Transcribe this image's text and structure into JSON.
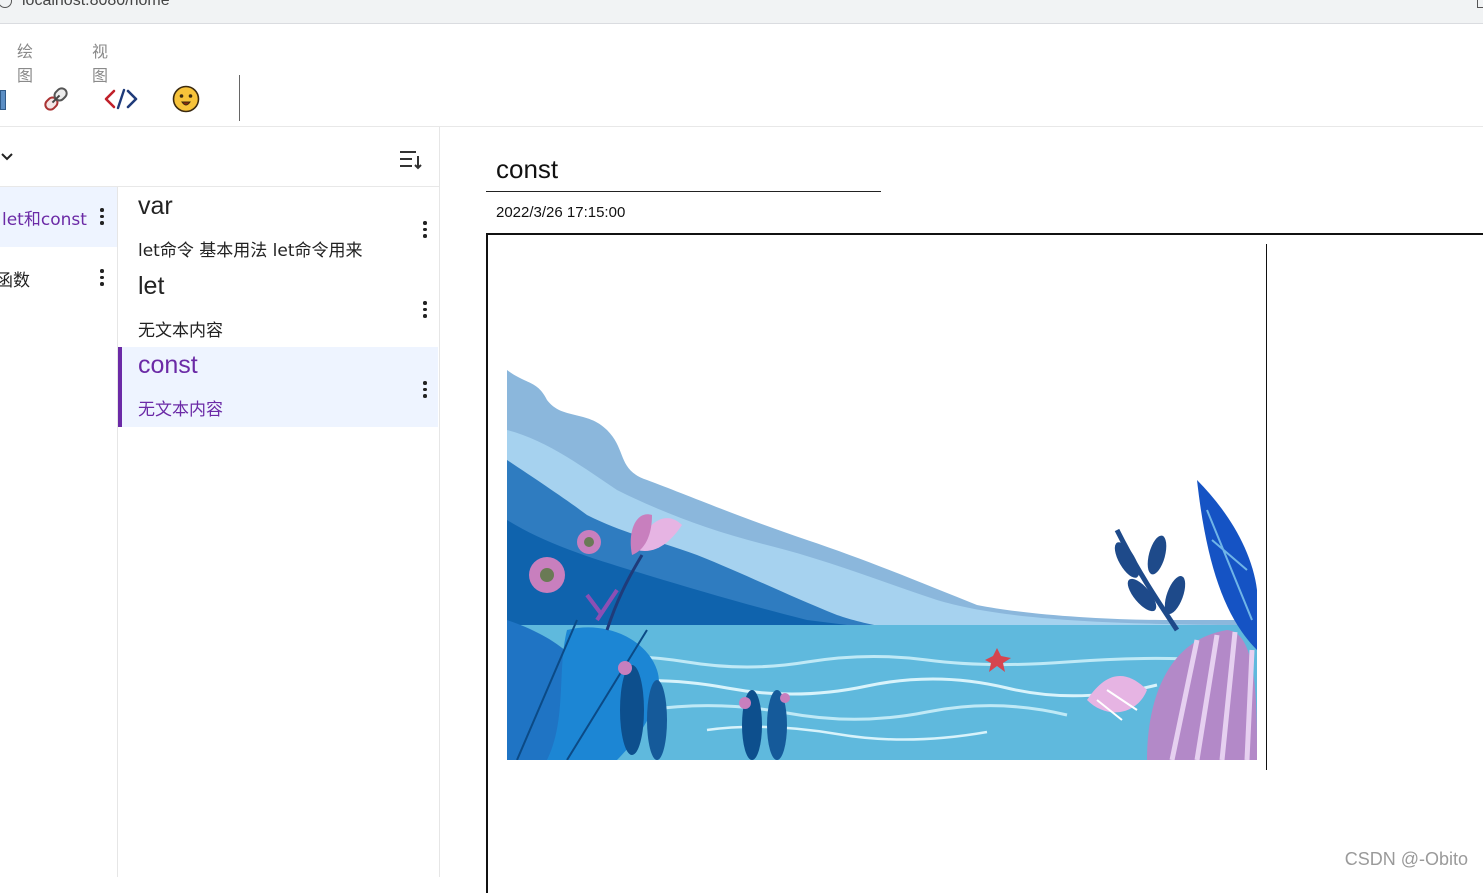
{
  "browser": {
    "url": "localhost:8080/home"
  },
  "menu": {
    "items": [
      "绘图",
      "视图"
    ]
  },
  "toolbar": {
    "tools": [
      "image-icon",
      "link-icon",
      "code-icon",
      "emoji-icon"
    ]
  },
  "notebooks": [
    {
      "label": "let和const",
      "active": true
    },
    {
      "label": "函数",
      "active": false
    }
  ],
  "notes": [
    {
      "title": "var",
      "snippet": "let命令 基本用法 let命令用来",
      "active": false
    },
    {
      "title": "let",
      "snippet": "无文本内容",
      "active": false
    },
    {
      "title": "const",
      "snippet": "无文本内容",
      "active": true
    }
  ],
  "editor": {
    "title": "const",
    "date": "2022/3/26 17:15:00"
  },
  "watermark": "CSDN @-Obito",
  "colors": {
    "accent": "#6b2aa6",
    "active_bg": "#eef4ff"
  }
}
